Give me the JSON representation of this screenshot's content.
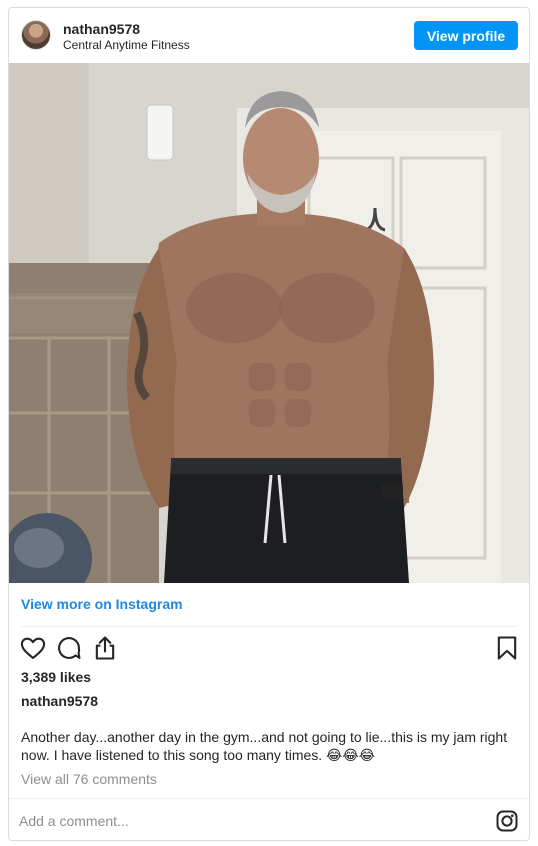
{
  "header": {
    "username": "nathan9578",
    "location": "Central Anytime Fitness",
    "view_profile_label": "View profile"
  },
  "photo": {
    "alt": "Shirtless muscular man with gray beard taking a selfie in a bathroom"
  },
  "links": {
    "view_more": "View more on Instagram"
  },
  "icons": {
    "like": "heart-icon",
    "comment": "comment-icon",
    "share": "share-icon",
    "save": "bookmark-icon",
    "instagram": "instagram-logo-icon"
  },
  "stats": {
    "likes": "3,389 likes"
  },
  "post": {
    "username": "nathan9578",
    "caption": "Another day...another day in the gym...and not going to lie...this is my jam right now. I have listened to this song too many times. 😂😂😂",
    "view_comments": "View all 76 comments"
  },
  "comment_box": {
    "placeholder": "Add a comment..."
  },
  "colors": {
    "accent": "#0095f6",
    "link": "#1c8ae3",
    "muted": "#8e8e8e",
    "border": "#dbdbdb"
  }
}
